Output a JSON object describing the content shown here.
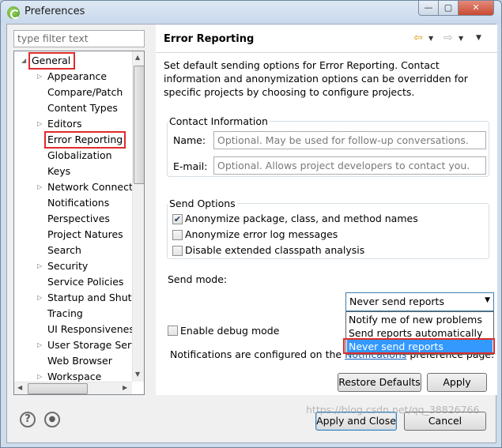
{
  "window": {
    "title": "Preferences",
    "controls": {
      "minimize": "—",
      "maximize": "▢",
      "close": "✕"
    }
  },
  "sidebar": {
    "filter_placeholder": "type filter text",
    "items": [
      {
        "label": "General",
        "expanded": true,
        "highlighted": true
      },
      {
        "label": "Appearance",
        "has_children": true
      },
      {
        "label": "Compare/Patch"
      },
      {
        "label": "Content Types"
      },
      {
        "label": "Editors",
        "has_children": true
      },
      {
        "label": "Error Reporting",
        "selected": true,
        "highlighted": true
      },
      {
        "label": "Globalization"
      },
      {
        "label": "Keys"
      },
      {
        "label": "Network Connecti",
        "has_children": true
      },
      {
        "label": "Notifications"
      },
      {
        "label": "Perspectives"
      },
      {
        "label": "Project Natures"
      },
      {
        "label": "Search"
      },
      {
        "label": "Security",
        "has_children": true
      },
      {
        "label": "Service Policies"
      },
      {
        "label": "Startup and Shutd",
        "has_children": true
      },
      {
        "label": "Tracing"
      },
      {
        "label": "UI Responsiveness"
      },
      {
        "label": "User Storage Serv",
        "has_children": true
      },
      {
        "label": "Web Browser"
      },
      {
        "label": "Workspace",
        "has_children": true
      }
    ]
  },
  "page": {
    "title": "Error Reporting",
    "description": "Set default sending options for Error Reporting. Contact information and anonymization options can be overridden for specific projects by choosing to configure projects.",
    "contact": {
      "legend": "Contact Information",
      "name_label": "Name:",
      "name_placeholder": "Optional. May be used for follow-up conversations.",
      "email_label": "E-mail:",
      "email_placeholder": "Optional. Allows project developers to contact you."
    },
    "send_options": {
      "legend": "Send Options",
      "options": [
        {
          "label": "Anonymize package, class, and method names",
          "checked": true
        },
        {
          "label": "Anonymize error log messages",
          "checked": false
        },
        {
          "label": "Disable extended classpath analysis",
          "checked": false
        }
      ]
    },
    "send_mode": {
      "label": "Send mode:",
      "value": "Never send reports",
      "options": [
        "Notify me of new problems",
        "Send reports automatically",
        "Never send reports"
      ],
      "selected_index": 2
    },
    "debug": {
      "label": "Enable debug mode",
      "checked": false
    },
    "notifications_prefix": "Notifications are configured on the",
    "notifications_link": "Notifications",
    "notifications_suffix": "preference page.",
    "restore_defaults": "Restore Defaults",
    "apply": "Apply"
  },
  "footer": {
    "help_icon": "?",
    "apply_close": "Apply and Close",
    "cancel": "Cancel"
  },
  "watermark": "https://blog.csdn.net/qq_38826766",
  "colors": {
    "highlight_box": "#e02b2b",
    "selection": "#3399ff",
    "link": "#0b57b7"
  }
}
